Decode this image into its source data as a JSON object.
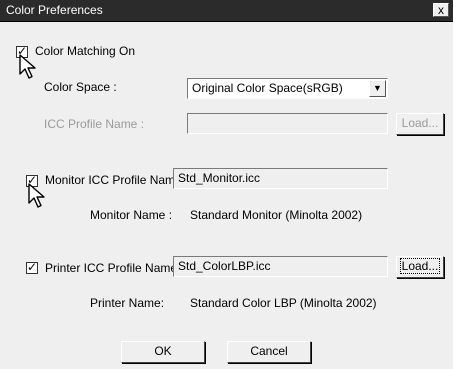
{
  "window": {
    "title": "Color Preferences",
    "close_label": "x"
  },
  "color_matching": {
    "label": "Color Matching On",
    "checked": true
  },
  "color_space": {
    "label": "Color Space :",
    "value": "Original Color Space(sRGB)"
  },
  "icc_profile": {
    "label": "ICC Profile Name :",
    "value": "",
    "load_label": "Load..."
  },
  "monitor_profile": {
    "label": "Monitor ICC Profile Name :",
    "value": "Std_Monitor.icc",
    "checked": true
  },
  "monitor_name": {
    "label": "Monitor Name :",
    "value": "Standard Monitor (Minolta 2002)"
  },
  "printer_profile": {
    "label": "Printer ICC Profile Name :",
    "value": "Std_ColorLBP.icc",
    "checked": true,
    "load_label": "Load..."
  },
  "printer_name": {
    "label": "Printer Name:",
    "value": "Standard Color LBP (Minolta 2002)"
  },
  "buttons": {
    "ok": "OK",
    "cancel": "Cancel"
  }
}
